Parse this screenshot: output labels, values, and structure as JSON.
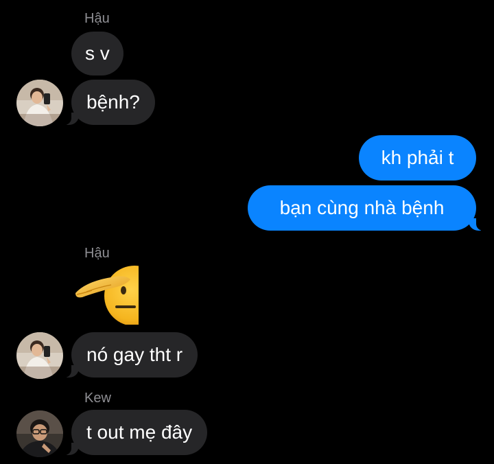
{
  "conversation": {
    "group1": {
      "sender": "Hậu",
      "messages": [
        "s v",
        "bệnh?"
      ]
    },
    "outgoing": {
      "messages": [
        "kh phải t",
        "bạn cùng nhà bệnh"
      ]
    },
    "group2": {
      "sender": "Hậu",
      "sticker": "saluting-face-emoji",
      "messages": [
        "nó gay tht r"
      ]
    },
    "group3": {
      "sender": "Kew",
      "messages": [
        "t out mẹ đây"
      ]
    }
  },
  "colors": {
    "background": "#000000",
    "incoming_bubble": "#262628",
    "outgoing_bubble": "#0A84FF",
    "sender_name": "#8E8E93"
  }
}
